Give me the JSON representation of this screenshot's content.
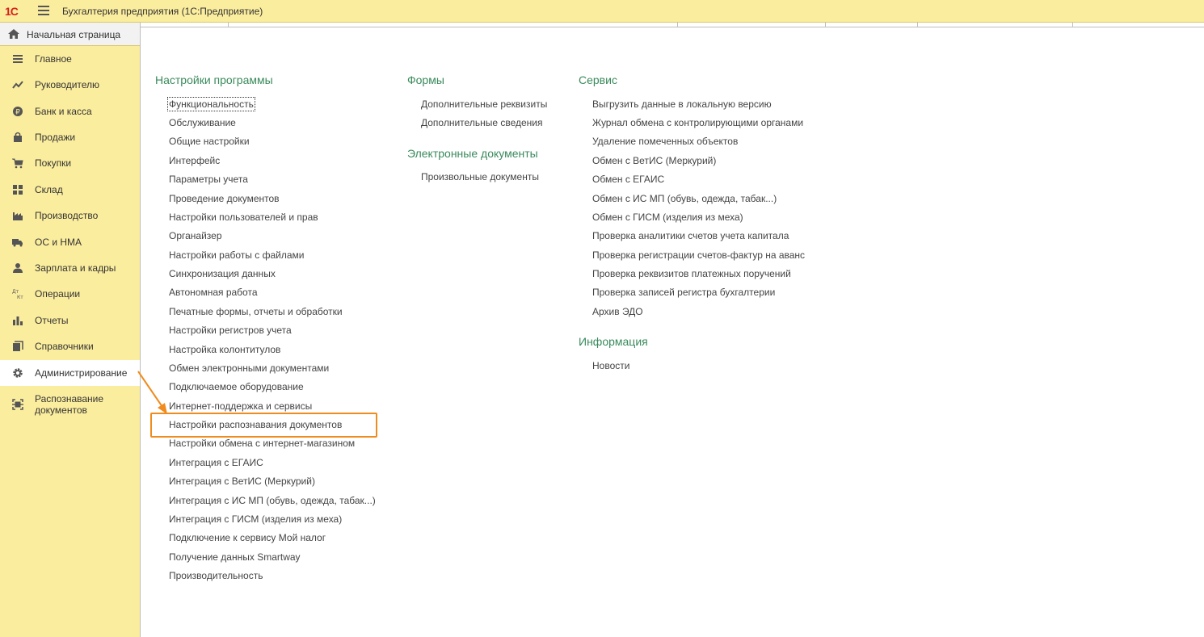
{
  "app": {
    "logo": "1С",
    "title": "Бухгалтерия предприятия  (1С:Предприятие)"
  },
  "sidebar": {
    "home": "Начальная страница",
    "items": [
      {
        "label": "Главное",
        "icon": "list-icon"
      },
      {
        "label": "Руководителю",
        "icon": "trend-icon"
      },
      {
        "label": "Банк и касса",
        "icon": "coin-icon"
      },
      {
        "label": "Продажи",
        "icon": "bag-icon"
      },
      {
        "label": "Покупки",
        "icon": "cart-icon"
      },
      {
        "label": "Склад",
        "icon": "warehouse-icon"
      },
      {
        "label": "Производство",
        "icon": "factory-icon"
      },
      {
        "label": "ОС и НМА",
        "icon": "truck-icon"
      },
      {
        "label": "Зарплата и кадры",
        "icon": "person-icon"
      },
      {
        "label": "Операции",
        "icon": "dt-kt-icon"
      },
      {
        "label": "Отчеты",
        "icon": "bar-chart-icon"
      },
      {
        "label": "Справочники",
        "icon": "books-icon"
      },
      {
        "label": "Администрирование",
        "icon": "gear-icon"
      },
      {
        "label": "Распознавание\nдокументов",
        "icon": "scan-icon"
      }
    ]
  },
  "sections": {
    "settings": {
      "title": "Настройки программы",
      "items": [
        "Функциональность",
        "Обслуживание",
        "Общие настройки",
        "Интерфейс",
        "Параметры учета",
        "Проведение документов",
        "Настройки пользователей и прав",
        "Органайзер",
        "Настройки работы с файлами",
        "Синхронизация данных",
        "Автономная работа",
        "Печатные формы, отчеты и обработки",
        "Настройки регистров учета",
        "Настройка колонтитулов",
        "Обмен электронными документами",
        "Подключаемое оборудование",
        "Интернет-поддержка и сервисы",
        "Настройки распознавания документов",
        "Настройки обмена с интернет-магазином",
        "Интеграция с ЕГАИС",
        "Интеграция с ВетИС (Меркурий)",
        "Интеграция с ИС МП (обувь, одежда, табак...)",
        "Интеграция с ГИСМ (изделия из меха)",
        "Подключение к сервису Мой налог",
        "Получение данных Smartway",
        "Производительность"
      ]
    },
    "forms": {
      "title": "Формы",
      "items": [
        "Дополнительные реквизиты",
        "Дополнительные сведения"
      ]
    },
    "edocs": {
      "title": "Электронные документы",
      "items": [
        "Произвольные документы"
      ]
    },
    "service": {
      "title": "Сервис",
      "items": [
        "Выгрузить данные в локальную версию",
        "Журнал обмена с контролирующими органами",
        "Удаление помеченных объектов",
        "Обмен с ВетИС (Меркурий)",
        "Обмен с ЕГАИС",
        "Обмен с ИС МП (обувь, одежда, табак...)",
        "Обмен с ГИСМ (изделия из меха)",
        "Проверка аналитики счетов учета капитала",
        "Проверка регистрации счетов-фактур на аванс",
        "Проверка реквизитов платежных поручений",
        "Проверка записей регистра бухгалтерии",
        "Архив ЭДО"
      ]
    },
    "info": {
      "title": "Информация",
      "items": [
        "Новости"
      ]
    }
  },
  "colors": {
    "sidebar_bg": "#fbed9e",
    "section_title": "#3a8a5b",
    "highlight": "#f08c1e"
  }
}
